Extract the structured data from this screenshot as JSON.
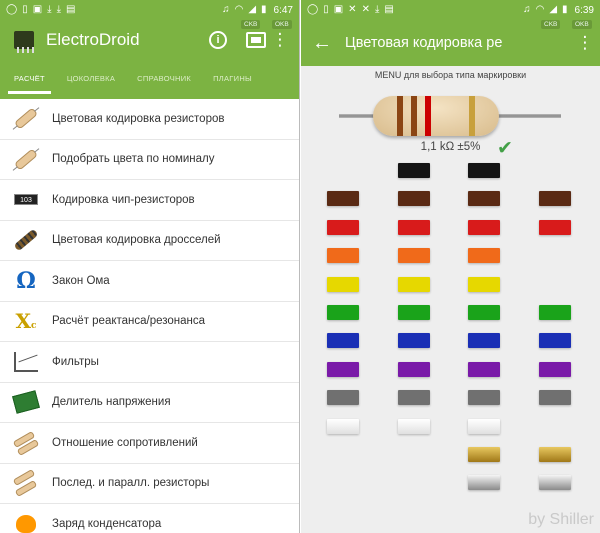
{
  "left": {
    "status": {
      "time": "6:47",
      "speed_left": "CKB",
      "speed_right": "OKB",
      "icons": [
        "whatsapp-icon",
        "notification-icon",
        "image-icon",
        "download-icon",
        "download-icon",
        "shop-icon",
        "whatsapp-icon",
        "headset-icon",
        "wifi-icon",
        "signal-icon",
        "battery-icon"
      ]
    },
    "app_title": "ElectroDroid",
    "tabs": [
      "РАСЧЁТ",
      "ЦОКОЛЕВКА",
      "СПРАВОЧНИК",
      "ПЛАГИНЫ"
    ],
    "menu": [
      {
        "label": "Цветовая кодировка резисторов",
        "icon": "resistor-icon"
      },
      {
        "label": "Подобрать цвета по номиналу",
        "icon": "resistor-icon"
      },
      {
        "label": "Кодировка чип-резисторов",
        "icon": "smd-chip-icon",
        "icon_text": "103"
      },
      {
        "label": "Цветовая кодировка дросселей",
        "icon": "inductor-icon"
      },
      {
        "label": "Закон Ома",
        "icon": "omega-icon",
        "icon_text": "Ω"
      },
      {
        "label": "Расчёт реактанса/резонанса",
        "icon": "reactance-icon",
        "icon_text": "X",
        "icon_sub": "c"
      },
      {
        "label": "Фильтры",
        "icon": "filter-icon"
      },
      {
        "label": "Делитель напряжения",
        "icon": "pcb-icon"
      },
      {
        "label": "Отношение сопротивлений",
        "icon": "resistor-pair-icon"
      },
      {
        "label": "Послед. и паралл. резисторы",
        "icon": "resistor-network-icon"
      },
      {
        "label": "Заряд конденсатора",
        "icon": "capacitor-icon"
      }
    ]
  },
  "right": {
    "status": {
      "time": "6:39",
      "speed_left": "CKB",
      "speed_right": "OKB"
    },
    "title": "Цветовая кодировка ре",
    "menu_hint": "MENU для выбора типа маркировки",
    "value": "1,1 kΩ ±5%",
    "bands_selected": [
      "#8b4513",
      "#8b4513",
      "#cc0000",
      "#c8a03c"
    ],
    "columns": [
      {
        "swatches": [
          "",
          "#5a2a14",
          "#d81b1b",
          "#f06a1a",
          "#e6d800",
          "#1aa31a",
          "#1a2fb5",
          "#7a1aa8",
          "#707070",
          "#f2f2f2",
          "",
          ""
        ]
      },
      {
        "swatches": [
          "#141414",
          "#5a2a14",
          "#d81b1b",
          "#f06a1a",
          "#e6d800",
          "#1aa31a",
          "#1a2fb5",
          "#7a1aa8",
          "#707070",
          "#f2f2f2",
          "",
          ""
        ]
      },
      {
        "swatches": [
          "#141414",
          "#5a2a14",
          "#d81b1b",
          "#f06a1a",
          "#e6d800",
          "#1aa31a",
          "#1a2fb5",
          "#7a1aa8",
          "#707070",
          "#f2f2f2",
          "#c9a030",
          "#bdbdbd"
        ]
      },
      {
        "swatches": [
          "",
          "#5a2a14",
          "#d81b1b",
          "",
          "",
          "#1aa31a",
          "#1a2fb5",
          "#7a1aa8",
          "#707070",
          "",
          "#c9a030",
          "#bdbdbd"
        ]
      }
    ],
    "watermark": "by Shiller"
  }
}
